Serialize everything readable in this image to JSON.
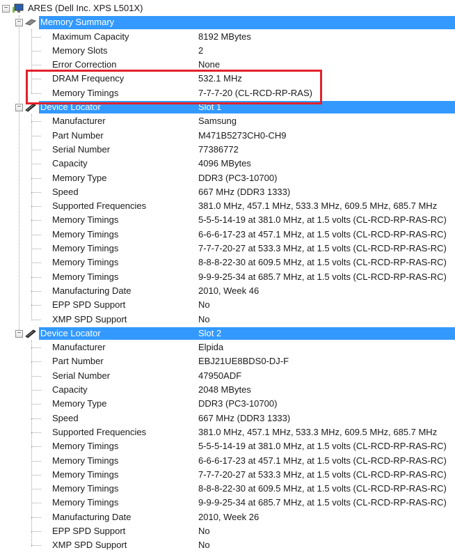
{
  "root": {
    "label": "ARES (Dell Inc. XPS L501X)"
  },
  "summary": {
    "label": "Memory Summary",
    "items": [
      {
        "label": "Maximum Capacity",
        "value": "8192 MBytes"
      },
      {
        "label": "Memory Slots",
        "value": "2"
      },
      {
        "label": "Error Correction",
        "value": "None"
      },
      {
        "label": "DRAM Frequency",
        "value": "532.1 MHz"
      },
      {
        "label": "Memory Timings",
        "value": "7-7-7-20 (CL-RCD-RP-RAS)"
      }
    ]
  },
  "slots": [
    {
      "label": "Device Locator",
      "value": "Slot 1",
      "items": [
        {
          "label": "Manufacturer",
          "value": "Samsung"
        },
        {
          "label": "Part Number",
          "value": "M471B5273CH0-CH9"
        },
        {
          "label": "Serial Number",
          "value": "77386772"
        },
        {
          "label": "Capacity",
          "value": "4096 MBytes"
        },
        {
          "label": "Memory Type",
          "value": "DDR3 (PC3-10700)"
        },
        {
          "label": "Speed",
          "value": "667 MHz (DDR3 1333)"
        },
        {
          "label": "Supported Frequencies",
          "value": "381.0 MHz, 457.1 MHz, 533.3 MHz, 609.5 MHz, 685.7 MHz"
        },
        {
          "label": "Memory Timings",
          "value": "5-5-5-14-19 at 381.0 MHz, at 1.5 volts (CL-RCD-RP-RAS-RC)"
        },
        {
          "label": "Memory Timings",
          "value": "6-6-6-17-23 at 457.1 MHz, at 1.5 volts (CL-RCD-RP-RAS-RC)"
        },
        {
          "label": "Memory Timings",
          "value": "7-7-7-20-27 at 533.3 MHz, at 1.5 volts (CL-RCD-RP-RAS-RC)"
        },
        {
          "label": "Memory Timings",
          "value": "8-8-8-22-30 at 609.5 MHz, at 1.5 volts (CL-RCD-RP-RAS-RC)"
        },
        {
          "label": "Memory Timings",
          "value": "9-9-9-25-34 at 685.7 MHz, at 1.5 volts (CL-RCD-RP-RAS-RC)"
        },
        {
          "label": "Manufacturing Date",
          "value": "2010, Week 46"
        },
        {
          "label": "EPP SPD Support",
          "value": "No"
        },
        {
          "label": "XMP SPD Support",
          "value": "No"
        }
      ]
    },
    {
      "label": "Device Locator",
      "value": "Slot 2",
      "items": [
        {
          "label": "Manufacturer",
          "value": "Elpida"
        },
        {
          "label": "Part Number",
          "value": "EBJ21UE8BDS0-DJ-F"
        },
        {
          "label": "Serial Number",
          "value": "47950ADF"
        },
        {
          "label": "Capacity",
          "value": "2048 MBytes"
        },
        {
          "label": "Memory Type",
          "value": "DDR3 (PC3-10700)"
        },
        {
          "label": "Speed",
          "value": "667 MHz (DDR3 1333)"
        },
        {
          "label": "Supported Frequencies",
          "value": "381.0 MHz, 457.1 MHz, 533.3 MHz, 609.5 MHz, 685.7 MHz"
        },
        {
          "label": "Memory Timings",
          "value": "5-5-5-14-19 at 381.0 MHz, at 1.5 volts (CL-RCD-RP-RAS-RC)"
        },
        {
          "label": "Memory Timings",
          "value": "6-6-6-17-23 at 457.1 MHz, at 1.5 volts (CL-RCD-RP-RAS-RC)"
        },
        {
          "label": "Memory Timings",
          "value": "7-7-7-20-27 at 533.3 MHz, at 1.5 volts (CL-RCD-RP-RAS-RC)"
        },
        {
          "label": "Memory Timings",
          "value": "8-8-8-22-30 at 609.5 MHz, at 1.5 volts (CL-RCD-RP-RAS-RC)"
        },
        {
          "label": "Memory Timings",
          "value": "9-9-9-25-34 at 685.7 MHz, at 1.5 volts (CL-RCD-RP-RAS-RC)"
        },
        {
          "label": "Manufacturing Date",
          "value": "2010, Week 26"
        },
        {
          "label": "EPP SPD Support",
          "value": "No"
        },
        {
          "label": "XMP SPD Support",
          "value": "No"
        }
      ]
    }
  ],
  "colors": {
    "selection": "#3399ff",
    "highlight_box": "#e3202a"
  }
}
